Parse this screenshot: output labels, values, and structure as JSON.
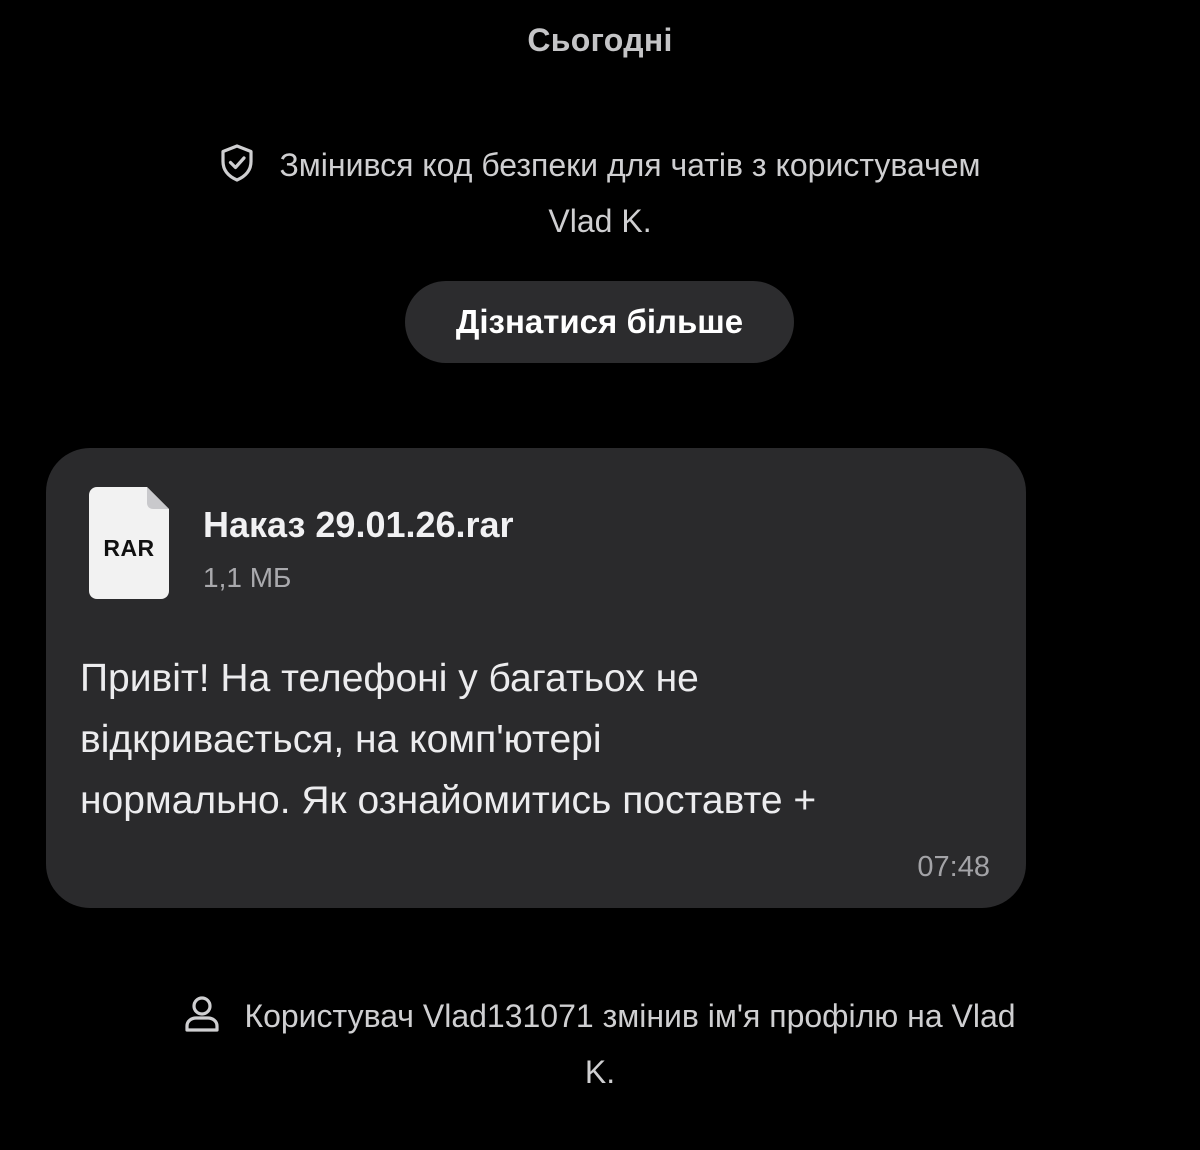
{
  "date_header": "Сьогодні",
  "security_notice": {
    "icon": "shield-check-icon",
    "lines": [
      "Змінився код безпеки для чатів з користувачем",
      "Vlad K."
    ]
  },
  "learn_more_button": "Дізнатися більше",
  "message": {
    "attachment": {
      "icon": "file-icon",
      "type_label": "RAR",
      "file_name": "Наказ 29.01.26.rar",
      "file_size": "1,1 МБ"
    },
    "text_lines": [
      "Привіт! На телефоні у багатьох не",
      "відкривається, на комп'ютері",
      "нормально. Як ознайомитись поставте +"
    ],
    "time": "07:48"
  },
  "profile_notice": {
    "icon": "person-icon",
    "lines": [
      "Користувач Vlad131071 змінив ім'я профілю на Vlad",
      "K."
    ]
  }
}
